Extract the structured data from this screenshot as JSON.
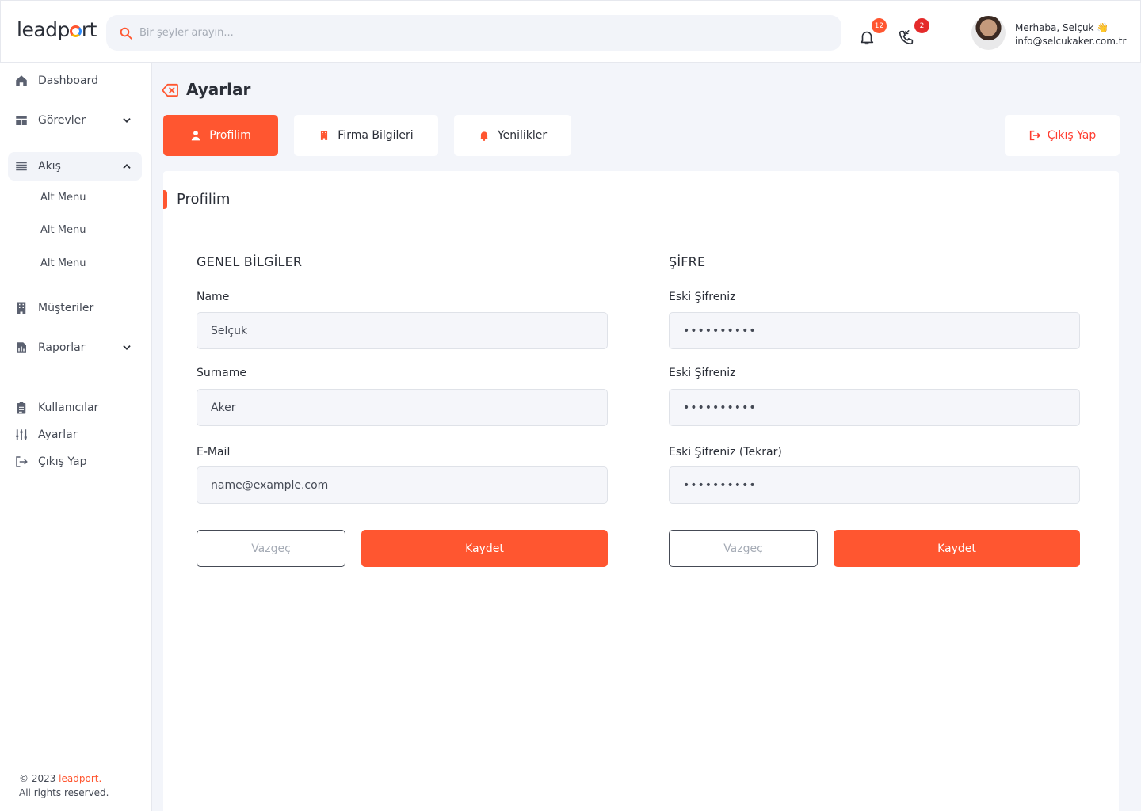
{
  "header": {
    "logo_pre": "leadp",
    "logo_post": "rt",
    "search_placeholder": "Bir şeyler arayın...",
    "notifications_count": "12",
    "calls_count": "2",
    "greeting": "Merhaba, Selçuk 👋",
    "email": "info@selcukaker.com.tr"
  },
  "sidebar": {
    "items": [
      {
        "label": "Dashboard"
      },
      {
        "label": "Görevler"
      },
      {
        "label": "Akış"
      },
      {
        "label": "Müşteriler"
      },
      {
        "label": "Raporlar"
      },
      {
        "label": "Kullanıcılar"
      },
      {
        "label": "Ayarlar"
      },
      {
        "label": "Çıkış Yap"
      }
    ],
    "sub_items": [
      {
        "label": "Alt Menu"
      },
      {
        "label": "Alt Menu"
      },
      {
        "label": "Alt Menu"
      }
    ],
    "footer_year": "© 2023 ",
    "footer_brand": "leadport.",
    "footer_rights": "All rights reserved."
  },
  "page": {
    "title": "Ayarlar",
    "tabs": [
      {
        "label": "Profilim",
        "active": true
      },
      {
        "label": "Firma Bilgileri",
        "active": false
      },
      {
        "label": "Yenilikler",
        "active": false
      }
    ],
    "logout_label": "Çıkış Yap"
  },
  "card": {
    "title": "Profilim",
    "general": {
      "title": "GENEL BİLGİLER",
      "name_label": "Name",
      "name_value": "Selçuk",
      "surname_label": "Surname",
      "surname_value": "Aker",
      "email_label": "E-Mail",
      "email_value": "name@example.com",
      "cancel_label": "Vazgeç",
      "save_label": "Kaydet"
    },
    "password": {
      "title": "ŞİFRE",
      "old_label": "Eski Şifreniz",
      "old_value": "••••••••••",
      "new_label": "Eski Şifreniz",
      "new_value": "••••••••••",
      "repeat_label": "Eski Şifreniz (Tekrar)",
      "repeat_value": "••••••••••",
      "cancel_label": "Vazgeç",
      "save_label": "Kaydet"
    }
  },
  "colors": {
    "accent": "#ff5630",
    "background": "#f3f5fa"
  }
}
